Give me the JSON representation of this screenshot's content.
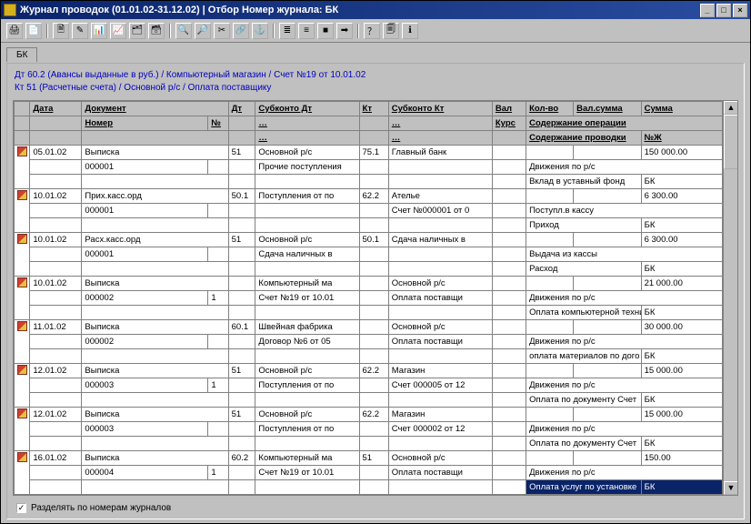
{
  "window": {
    "title": "Журнал проводок (01.01.02-31.12.02) | Отбор Номер журнала: БК"
  },
  "toolbar": {
    "icons": [
      "print-icon",
      "copy-icon",
      "new-doc-icon",
      "edit-icon",
      "export-icon",
      "chart-icon",
      "report-icon",
      "layers-icon",
      "search-icon",
      "magnify-icon",
      "cut-icon",
      "link-icon",
      "anchor-icon",
      "list-icon",
      "align-icon",
      "block-icon",
      "arrow-icon",
      "help-icon",
      "page-icon",
      "info-icon"
    ]
  },
  "tab": {
    "label": "БК"
  },
  "context": {
    "line1": "Дт 60.2 (Авансы выданные в руб.) / Компьютерный магазин / Счет №19 от 10.01.02",
    "line2": "Кт 51 (Расчетные счета) / Основной р/с / Оплата поставщику"
  },
  "headers": {
    "row1": {
      "date": "Дата",
      "doc": "Документ",
      "dt": "Дт",
      "subdt": "Субконто Дт",
      "kt": "Кт",
      "subkt": "Субконто Кт",
      "val": "Вал",
      "kolvo": "Кол-во",
      "valsum": "Вал.сумма",
      "sum": "Сумма"
    },
    "row2": {
      "nomer": "Номер",
      "no": "№",
      "ellips": "…",
      "kurs": "Курс",
      "soder": "Содержание операции"
    },
    "row3": {
      "soder2": "Содержание проводки",
      "nzh": "№Ж"
    }
  },
  "rows": [
    {
      "date": "05.01.02",
      "doc": "Выписка",
      "nomer": "000001",
      "no": "",
      "dt": "51",
      "subdt1": "Основной р/с",
      "subdt2": "Прочие поступления",
      "kt": "75.1",
      "subkt1": "Главный банк",
      "subkt2": "",
      "val": "",
      "kurs": "",
      "kolvo": "",
      "valsum": "",
      "sum": "150 000.00",
      "soder1": "Движения по р/с",
      "soder2": "Вклад в уставный фонд",
      "nzh": "БК"
    },
    {
      "date": "10.01.02",
      "doc": "Прих.касс.орд",
      "nomer": "000001",
      "no": "",
      "dt": "50.1",
      "subdt1": "Поступления от по",
      "subdt2": "",
      "kt": "62.2",
      "subkt1": "Ателье",
      "subkt2": "Счет №000001 от 0",
      "val": "",
      "kurs": "",
      "kolvo": "",
      "valsum": "",
      "sum": "6 300.00",
      "soder1": "Поступл.в кассу",
      "soder2": "Приход",
      "nzh": "БК"
    },
    {
      "date": "10.01.02",
      "doc": "Расх.касс.орд",
      "nomer": "000001",
      "no": "",
      "dt": "51",
      "subdt1": "Основной р/с",
      "subdt2": "Сдача наличных в",
      "kt": "50.1",
      "subkt1": "Сдача наличных в",
      "subkt2": "",
      "val": "",
      "kurs": "",
      "kolvo": "",
      "valsum": "",
      "sum": "6 300.00",
      "soder1": "Выдача из кассы",
      "soder2": "Расход",
      "nzh": "БК"
    },
    {
      "date": "10.01.02",
      "doc": "Выписка",
      "nomer": "000002",
      "no": "1",
      "dt": "",
      "subdt1": "Компьютерный ма",
      "subdt2": "Счет №19 от 10.01",
      "kt": "",
      "subkt1": "Основной р/с",
      "subkt2": "Оплата поставщи",
      "val": "",
      "kurs": "",
      "kolvo": "",
      "valsum": "",
      "sum": "21 000.00",
      "soder1": "Движения по р/с",
      "soder2": "Оплата компьютерной техни",
      "nzh": "БК"
    },
    {
      "date": "11.01.02",
      "doc": "Выписка",
      "nomer": "000002",
      "no": "",
      "dt": "60.1",
      "subdt1": "Швейная фабрика",
      "subdt2": "Договор №6 от 05",
      "kt": "",
      "subkt1": "Основной р/с",
      "subkt2": "Оплата поставщи",
      "val": "",
      "kurs": "",
      "kolvo": "",
      "valsum": "",
      "sum": "30 000.00",
      "soder1": "Движения по р/с",
      "soder2": "оплата материалов по дого",
      "nzh": "БК"
    },
    {
      "date": "12.01.02",
      "doc": "Выписка",
      "nomer": "000003",
      "no": "1",
      "dt": "51",
      "subdt1": "Основной р/с",
      "subdt2": "Поступления от по",
      "kt": "62.2",
      "subkt1": "Магазин",
      "subkt2": "Счет 000005 от 12",
      "val": "",
      "kurs": "",
      "kolvo": "",
      "valsum": "",
      "sum": "15 000.00",
      "soder1": "Движения по р/с",
      "soder2": "Оплата по документу Счет",
      "nzh": "БК"
    },
    {
      "date": "12.01.02",
      "doc": "Выписка",
      "nomer": "000003",
      "no": "",
      "dt": "51",
      "subdt1": "Основной р/с",
      "subdt2": "Поступления от по",
      "kt": "62.2",
      "subkt1": "Магазин",
      "subkt2": "Счет 000002 от 12",
      "val": "",
      "kurs": "",
      "kolvo": "",
      "valsum": "",
      "sum": "15 000.00",
      "soder1": "Движения по р/с",
      "soder2": "Оплата по документу Счет",
      "nzh": "БК"
    },
    {
      "date": "16.01.02",
      "doc": "Выписка",
      "nomer": "000004",
      "no": "1",
      "dt": "60.2",
      "subdt1": "Компьютерный ма",
      "subdt2": "Счет №19 от 10.01",
      "kt": "51",
      "subkt1": "Основной р/с",
      "subkt2": "Оплата поставщи",
      "val": "",
      "kurs": "",
      "kolvo": "",
      "valsum": "",
      "sum": "150.00",
      "soder1": "Движения по р/с",
      "soder2": "Оплата услуг по установке",
      "nzh": "БК",
      "highlight": true
    }
  ],
  "footer": {
    "checked": true,
    "label": "Разделять по номерам журналов"
  }
}
